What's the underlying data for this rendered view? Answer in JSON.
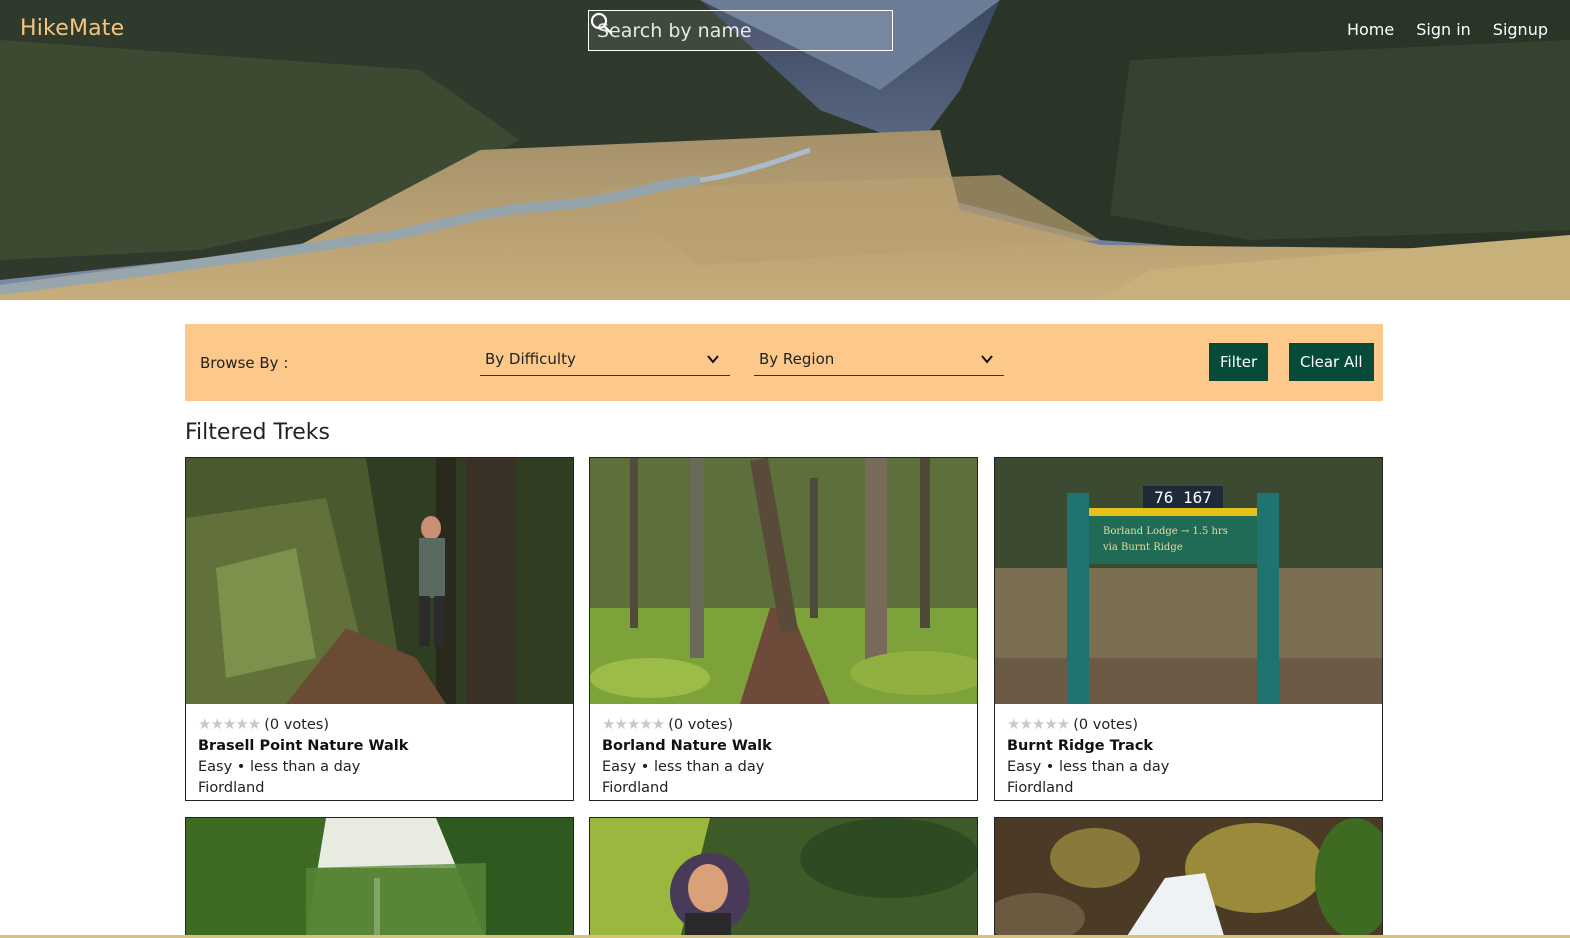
{
  "header": {
    "brand": "HikeMate",
    "search_placeholder": "Search by name",
    "nav": [
      "Home",
      "Sign in",
      "Signup"
    ]
  },
  "filter": {
    "browse_label": "Browse By :",
    "difficulty_select": "By Difficulty",
    "region_select": "By Region",
    "filter_button": "Filter",
    "clear_button": "Clear All"
  },
  "section_title": "Filtered Treks",
  "treks": [
    {
      "stars": "★★★★★",
      "votes": "(0 votes)",
      "name": "Brasell Point Nature Walk",
      "details": "Easy • less than a day",
      "region": "Fiordland"
    },
    {
      "stars": "★★★★★",
      "votes": "(0 votes)",
      "name": "Borland Nature Walk",
      "details": "Easy • less than a day",
      "region": "Fiordland"
    },
    {
      "stars": "★★★★★",
      "votes": "(0 votes)",
      "name": "Burnt Ridge Track",
      "details": "Easy • less than a day",
      "region": "Fiordland"
    }
  ],
  "rating": {
    "filled": 0,
    "max": 5
  },
  "sign": {
    "number": "76 167",
    "line1": "Borland Lodge → 1.5 hrs",
    "line2": "via Burnt Ridge"
  },
  "colors": {
    "brand": "#f5c57e",
    "filter_bar": "#fdc98a",
    "button": "#064a3a",
    "star_empty": "#c9c9c9"
  },
  "icons": {
    "search": "search-icon",
    "dropdown": "chevron-down-icon"
  }
}
